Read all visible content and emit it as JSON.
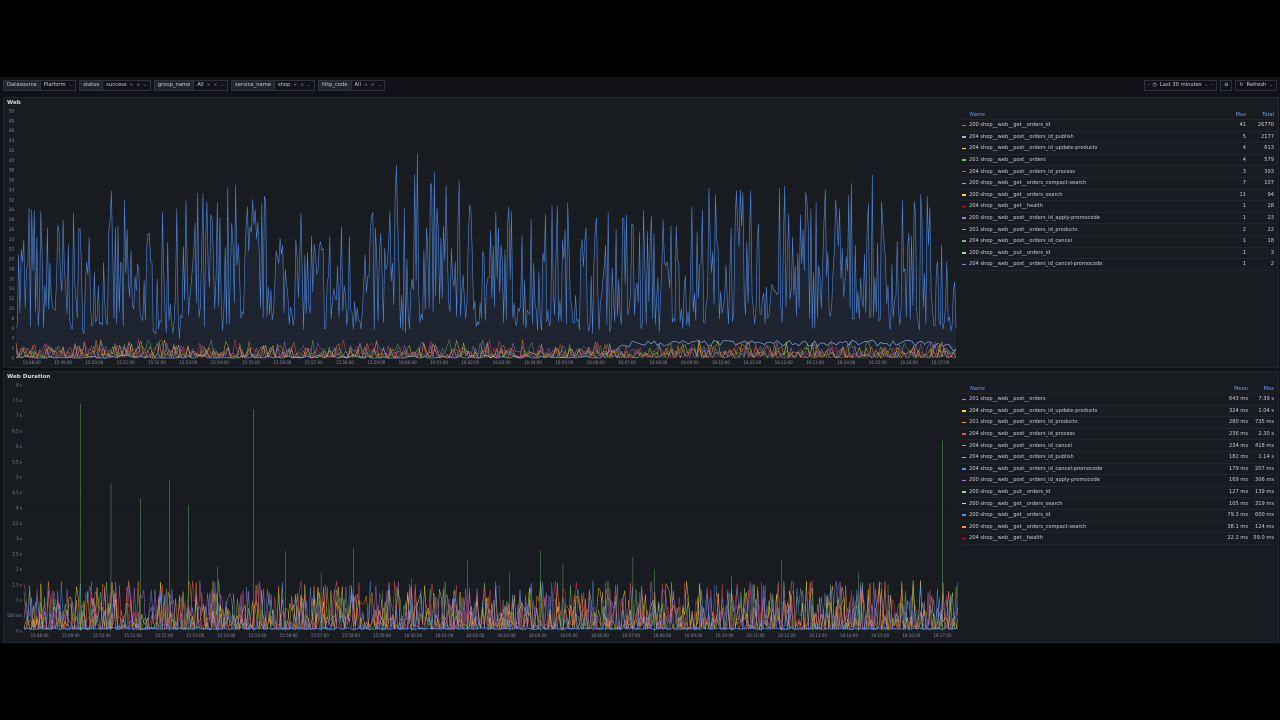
{
  "toolbar": {
    "variables": [
      {
        "label": "Datasource",
        "value": "Platform",
        "removable": false
      },
      {
        "label": "status",
        "value": "success",
        "removable": true
      },
      {
        "label": "group_name",
        "value": "All",
        "removable": true
      },
      {
        "label": "service_name",
        "value": "shop",
        "removable": true
      },
      {
        "label": "http_code",
        "value": "All",
        "removable": true
      }
    ],
    "time_range": "Last 30 minutes",
    "refresh_label": "Refresh"
  },
  "colors": {
    "background": "#111217",
    "panel": "#181b1f",
    "accent": "#6e9fff",
    "blue": "#5794f2",
    "green": "#73bf69",
    "yellow": "#fade2a",
    "orange": "#ff9830",
    "red": "#f2495c",
    "purple": "#b877d9"
  },
  "panels": [
    {
      "title": "Web",
      "legend_headers": {
        "name": "Name",
        "col1": "Max",
        "col2": "Total"
      },
      "legend": [
        {
          "name": "200 shop__web__get__orders_id",
          "v1": "41",
          "v2": "26770",
          "color": "#5794f2"
        },
        {
          "name": "204 shop__web__post__orders_id_publish",
          "v1": "5",
          "v2": "2177",
          "color": "#8ab8ff"
        },
        {
          "name": "204 shop__web__post__orders_id_update-products",
          "v1": "4",
          "v2": "613",
          "color": "#fade2a"
        },
        {
          "name": "201 shop__web__post__orders",
          "v1": "4",
          "v2": "579",
          "color": "#73bf69"
        },
        {
          "name": "204 shop__web__post__orders_id_process",
          "v1": "3",
          "v2": "393",
          "color": "#f2495c"
        },
        {
          "name": "200 shop__web__get__orders_compact-search",
          "v1": "7",
          "v2": "107",
          "color": "#ff9830"
        },
        {
          "name": "200 shop__web__get__orders_search",
          "v1": "11",
          "v2": "94",
          "color": "#fade2a"
        },
        {
          "name": "204 shop__web__get__health",
          "v1": "1",
          "v2": "28",
          "color": "#c4162a"
        },
        {
          "name": "200 shop__web__post__orders_id_apply-promocode",
          "v1": "1",
          "v2": "23",
          "color": "#b877d9"
        },
        {
          "name": "201 shop__web__post__orders_id_products",
          "v1": "2",
          "v2": "22",
          "color": "#ff7383"
        },
        {
          "name": "204 shop__web__post__orders_id_cancel",
          "v1": "1",
          "v2": "18",
          "color": "#73bf69"
        },
        {
          "name": "200 shop__web__put__orders_id",
          "v1": "1",
          "v2": "3",
          "color": "#96d98d"
        },
        {
          "name": "204 shop__web__post__orders_id_cancel-promocode",
          "v1": "1",
          "v2": "2",
          "color": "#5794f2"
        }
      ],
      "y_ticks": [
        "0",
        "2",
        "4",
        "6",
        "8",
        "10",
        "12",
        "14",
        "16",
        "18",
        "20",
        "22",
        "24",
        "26",
        "28",
        "30",
        "32",
        "34",
        "36",
        "38",
        "40",
        "42",
        "44",
        "46",
        "48",
        "50"
      ],
      "x_ticks": [
        "15:48:00",
        "15:49:00",
        "15:50:00",
        "15:51:00",
        "15:52:00",
        "15:53:00",
        "15:54:00",
        "15:55:00",
        "15:56:00",
        "15:57:00",
        "15:58:00",
        "15:59:00",
        "16:00:00",
        "16:01:00",
        "16:02:00",
        "16:03:00",
        "16:04:00",
        "16:05:00",
        "16:06:00",
        "16:07:00",
        "16:08:00",
        "16:09:00",
        "16:10:00",
        "16:11:00",
        "16:12:00",
        "16:13:00",
        "16:14:00",
        "16:15:00",
        "16:16:00",
        "16:17:00"
      ]
    },
    {
      "title": "Web Duration",
      "legend_headers": {
        "name": "Name",
        "col1": "Mean",
        "col2": "Max"
      },
      "legend": [
        {
          "name": "201 shop__web__post__orders",
          "v1": "643 ms",
          "v2": "7.39 s",
          "color": "#73bf69"
        },
        {
          "name": "204 shop__web__post__orders_id_update-products",
          "v1": "324 ms",
          "v2": "1.04 s",
          "color": "#fade2a"
        },
        {
          "name": "201 shop__web__post__orders_id_products",
          "v1": "280 ms",
          "v2": "735 ms",
          "color": "#ff9830"
        },
        {
          "name": "204 shop__web__post__orders_id_process",
          "v1": "236 ms",
          "v2": "2.30 s",
          "color": "#f2495c"
        },
        {
          "name": "204 shop__web__post__orders_id_cancel",
          "v1": "234 ms",
          "v2": "418 ms",
          "color": "#73bf69"
        },
        {
          "name": "204 shop__web__post__orders_id_publish",
          "v1": "182 ms",
          "v2": "1.14 s",
          "color": "#8ab8ff"
        },
        {
          "name": "204 shop__web__post__orders_id_cancel-promocode",
          "v1": "179 ms",
          "v2": "207 ms",
          "color": "#5794f2"
        },
        {
          "name": "200 shop__web__post__orders_id_apply-promocode",
          "v1": "169 ms",
          "v2": "306 ms",
          "color": "#b877d9"
        },
        {
          "name": "200 shop__web__put__orders_id",
          "v1": "127 ms",
          "v2": "139 ms",
          "color": "#96d98d"
        },
        {
          "name": "200 shop__web__get__orders_search",
          "v1": "105 ms",
          "v2": "319 ms",
          "color": "#fade2a"
        },
        {
          "name": "200 shop__web__get__orders_id",
          "v1": "79.3 ms",
          "v2": "600 ms",
          "color": "#5794f2"
        },
        {
          "name": "200 shop__web__get__orders_compact-search",
          "v1": "38.1 ms",
          "v2": "124 ms",
          "color": "#ff9830"
        },
        {
          "name": "204 shop__web__get__health",
          "v1": "22.2 ms",
          "v2": "59.0 ms",
          "color": "#c4162a"
        }
      ],
      "y_ticks": [
        "0 s",
        "500 ms",
        "1 s",
        "1.5 s",
        "2 s",
        "2.5 s",
        "3 s",
        "3.5 s",
        "4 s",
        "4.5 s",
        "5 s",
        "5.5 s",
        "6 s",
        "6.5 s",
        "7 s",
        "7.5 s",
        "8 s"
      ],
      "x_ticks": [
        "15:48:00",
        "15:49:00",
        "15:50:00",
        "15:51:00",
        "15:52:00",
        "15:53:00",
        "15:54:00",
        "15:55:00",
        "15:56:00",
        "15:57:00",
        "15:58:00",
        "15:59:00",
        "16:00:00",
        "16:01:00",
        "16:02:00",
        "16:03:00",
        "16:04:00",
        "16:05:00",
        "16:06:00",
        "16:07:00",
        "16:08:00",
        "16:09:00",
        "16:10:00",
        "16:11:00",
        "16:12:00",
        "16:13:00",
        "16:14:00",
        "16:15:00",
        "16:16:00",
        "16:17:00"
      ]
    }
  ],
  "chart_data": [
    {
      "type": "line",
      "title": "Web",
      "ylim": [
        0,
        50
      ],
      "x": [
        "15:48:00",
        "15:49:00",
        "15:50:00",
        "15:51:00",
        "15:52:00",
        "15:53:00",
        "15:54:00",
        "15:55:00",
        "15:56:00",
        "15:57:00",
        "15:58:00",
        "15:59:00",
        "16:00:00",
        "16:01:00",
        "16:02:00",
        "16:03:00",
        "16:04:00",
        "16:05:00",
        "16:06:00",
        "16:07:00",
        "16:08:00",
        "16:09:00",
        "16:10:00",
        "16:11:00",
        "16:12:00",
        "16:13:00",
        "16:14:00",
        "16:15:00",
        "16:16:00",
        "16:17:00"
      ],
      "series": [
        {
          "name": "200 shop__web__get__orders_id",
          "values": [
            14,
            20,
            18,
            16,
            19,
            15,
            17,
            22,
            26,
            18,
            20,
            17,
            15,
            30,
            20,
            22,
            18,
            21,
            17,
            19,
            18,
            20,
            22,
            19,
            21,
            20,
            23,
            19,
            20,
            18
          ],
          "peaks": [
            35,
            32,
            30,
            33,
            28,
            32,
            36,
            38,
            33,
            30,
            29,
            31,
            45,
            38,
            35,
            32,
            34,
            33,
            30,
            35,
            31,
            35,
            36,
            34,
            38,
            40,
            36,
            35,
            33,
            30
          ]
        },
        {
          "name": "204 shop__web__post__orders_id_publish",
          "values": [
            0,
            0,
            0,
            0,
            0,
            0,
            0,
            0,
            0,
            0,
            0,
            0,
            0,
            0,
            0,
            0,
            0,
            0,
            0,
            3,
            3,
            3,
            3,
            3,
            3,
            3,
            3,
            3,
            3,
            2
          ]
        },
        {
          "name": "201 shop__web__post__orders",
          "values": [
            1,
            1,
            1,
            1,
            1,
            1,
            1,
            1,
            1,
            1,
            1,
            1,
            1,
            1,
            1,
            1,
            1,
            1,
            1,
            1,
            1,
            1,
            1,
            1,
            1,
            1,
            1,
            1,
            1,
            1
          ]
        }
      ]
    },
    {
      "type": "line",
      "title": "Web Duration",
      "ylim": [
        0,
        8
      ],
      "x": [
        "15:48:00",
        "15:49:00",
        "15:50:00",
        "15:51:00",
        "15:52:00",
        "15:53:00",
        "15:54:00",
        "15:55:00",
        "15:56:00",
        "15:57:00",
        "15:58:00",
        "15:59:00",
        "16:00:00",
        "16:01:00",
        "16:02:00",
        "16:03:00",
        "16:04:00",
        "16:05:00",
        "16:06:00",
        "16:07:00",
        "16:08:00",
        "16:09:00",
        "16:10:00",
        "16:11:00",
        "16:12:00",
        "16:13:00",
        "16:14:00",
        "16:15:00",
        "16:16:00",
        "16:17:00"
      ],
      "series": [
        {
          "name": "201 shop__web__post__orders",
          "values": [
            0.6,
            7.39,
            0.7,
            0.6,
            0.7,
            0.6,
            0.6,
            0.6,
            7.2,
            0.6,
            0.6,
            0.6,
            0.6,
            0.6,
            0.6,
            0.6,
            0.6,
            0.6,
            0.7,
            0.6,
            0.6,
            0.6,
            0.6,
            0.6,
            0.6,
            0.6,
            0.6,
            0.6,
            0.6,
            0.6
          ]
        },
        {
          "name": "200 shop__web__get__orders_id",
          "values": [
            0.08,
            0.08,
            0.08,
            0.08,
            0.08,
            0.08,
            0.08,
            0.08,
            0.08,
            0.08,
            0.08,
            0.08,
            0.08,
            0.08,
            0.08,
            0.08,
            0.08,
            0.08,
            0.08,
            0.08,
            0.08,
            0.08,
            0.08,
            0.08,
            0.08,
            0.08,
            0.08,
            0.08,
            0.08,
            0.08
          ]
        }
      ],
      "spikes_s": [
        0.35,
        7.39,
        4.8,
        4.3,
        4.9,
        4.1,
        2.1,
        7.2,
        2.6,
        1.9,
        2.7,
        1.3,
        1.7,
        1.3,
        2.3,
        1.9,
        2.6,
        2.2,
        1.6,
        2.4,
        2.0,
        1.1,
        1.8,
        1.6,
        2.3,
        1.4,
        1.9,
        1.5,
        1.1,
        6.2
      ]
    }
  ]
}
